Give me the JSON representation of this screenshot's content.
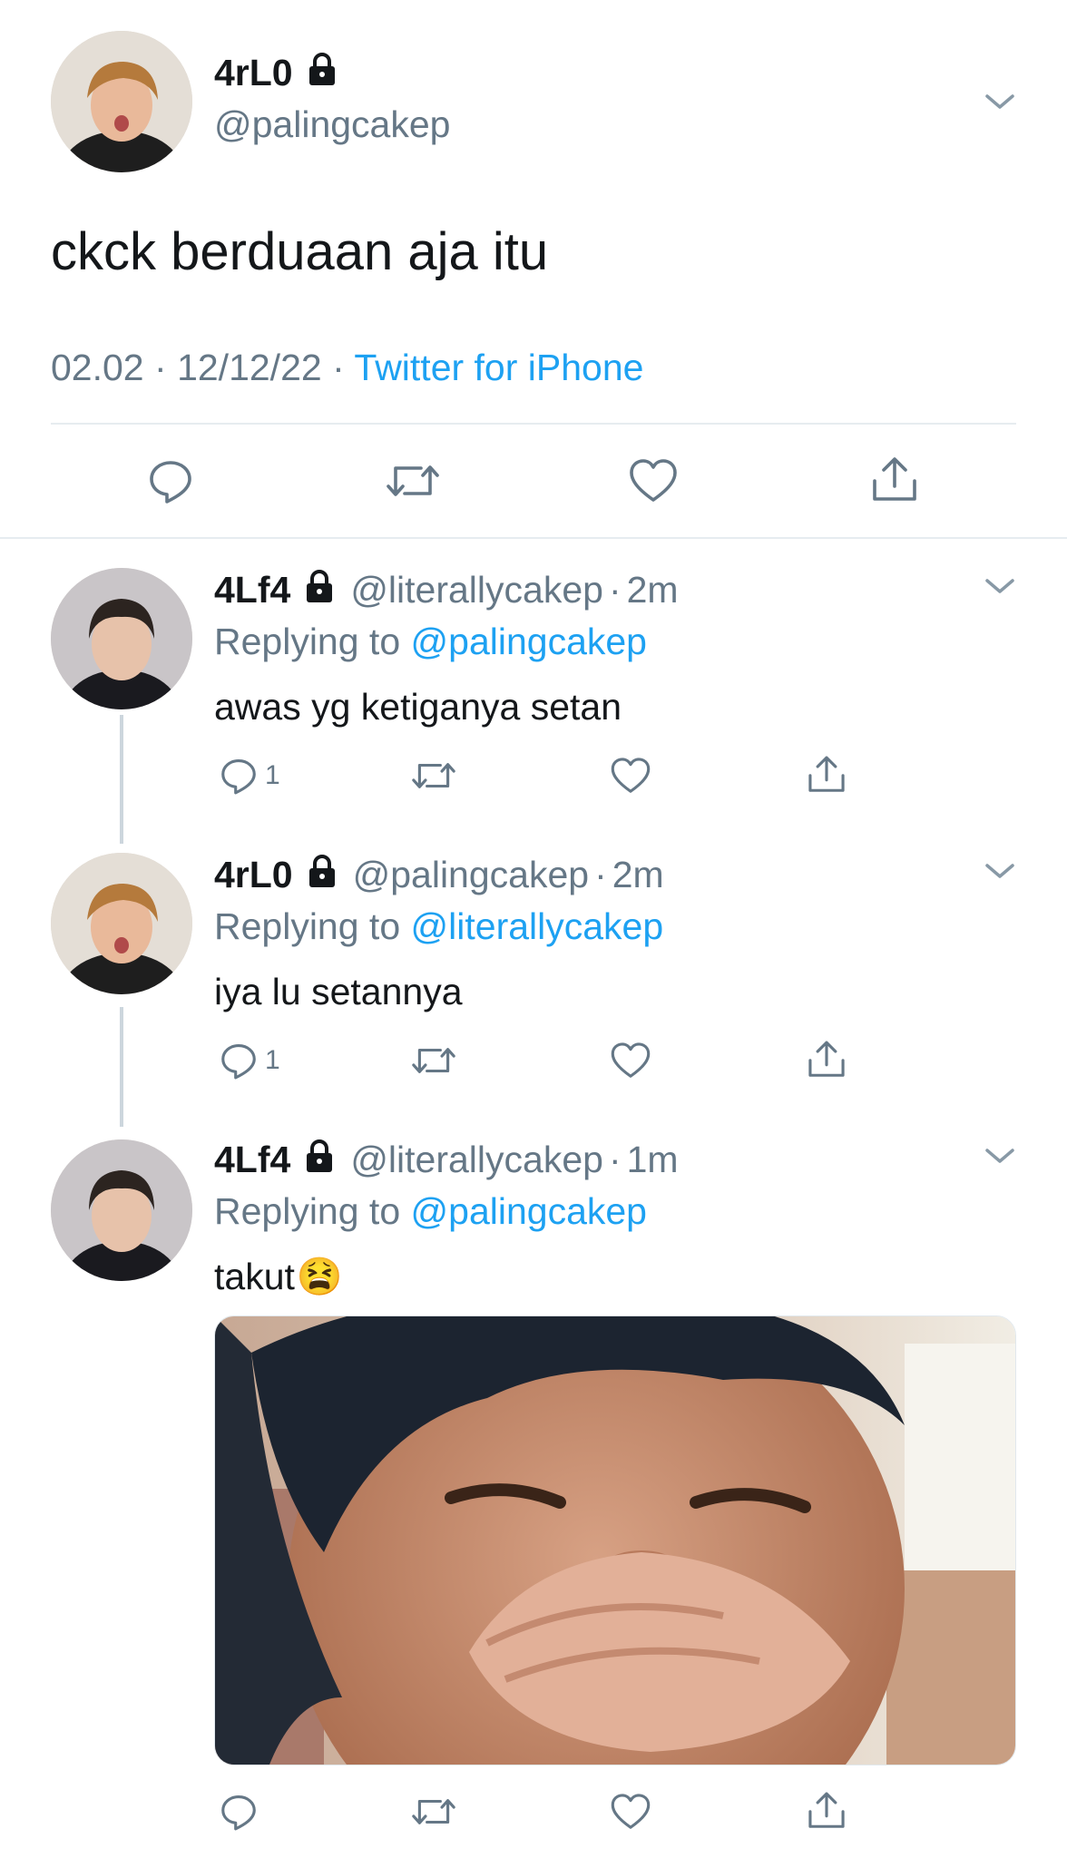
{
  "main_tweet": {
    "display_name": "4rL0",
    "handle": "@palingcakep",
    "text": "ckck berduaan aja itu",
    "time": "02.02",
    "separator": "·",
    "date": "12/12/22",
    "source": "Twitter for iPhone"
  },
  "replies": [
    {
      "display_name": "4Lf4",
      "handle": "@literallycakep",
      "time": "2m",
      "replying_prefix": "Replying to",
      "replying_to": "@palingcakep",
      "text": "awas yg ketiganya setan",
      "reply_count": "1"
    },
    {
      "display_name": "4rL0",
      "handle": "@palingcakep",
      "time": "2m",
      "replying_prefix": "Replying to",
      "replying_to": "@literallycakep",
      "text": "iya lu setannya",
      "reply_count": "1"
    },
    {
      "display_name": "4Lf4",
      "handle": "@literallycakep",
      "time": "1m",
      "replying_prefix": "Replying to",
      "replying_to": "@palingcakep",
      "text": "takut",
      "emoji": "😫"
    }
  ],
  "colors": {
    "link": "#1da1f2",
    "muted": "#657786",
    "divider": "#e6ecf0",
    "icon": "#657786"
  }
}
